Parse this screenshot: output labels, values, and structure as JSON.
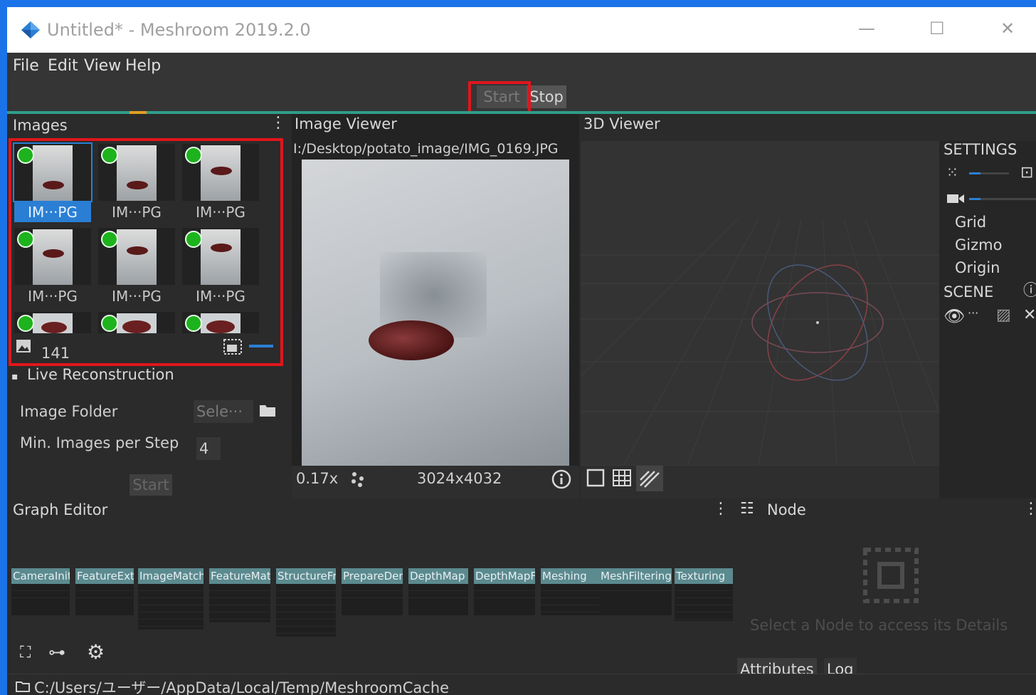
{
  "window": {
    "title": "Untitled* - Meshroom 2019.2.0",
    "minimize": "—",
    "maximize": "☐",
    "close": "✕"
  },
  "menu": [
    "File",
    "Edit",
    "View",
    "Help"
  ],
  "toolbar": {
    "start": "Start",
    "stop": "Stop"
  },
  "images": {
    "title": "Images",
    "thumbnails": [
      "IM···PG",
      "IM···PG",
      "IM···PG",
      "IM···PG",
      "IM···PG",
      "IM···PG"
    ],
    "count": "141"
  },
  "live": {
    "title": "Live Reconstruction",
    "folder_label": "Image Folder",
    "folder_placeholder": "Sele···",
    "min_label": "Min. Images per Step",
    "min_value": "4",
    "start": "Start"
  },
  "image_viewer": {
    "title": "Image Viewer",
    "path": "I:/Desktop/potato_image/IMG_0169.JPG",
    "zoom": "0.17x",
    "resolution": "3024x4032"
  },
  "viewer3d": {
    "title": "3D Viewer",
    "settings": "SETTINGS",
    "grid": "Grid",
    "gizmo": "Gizmo",
    "origin": "Origin",
    "scene": "SCENE"
  },
  "graph": {
    "title": "Graph Editor",
    "nodes": [
      "CameraInit",
      "FeatureExtraction",
      "ImageMatching",
      "FeatureMatching",
      "StructureFromMotion",
      "PrepareDenseScene",
      "DepthMap",
      "DepthMapFilter",
      "Meshing",
      "MeshFiltering",
      "Texturing"
    ]
  },
  "node_panel": {
    "title": "Node",
    "message": "Select a Node to access its Details",
    "tab_attributes": "Attributes",
    "tab_log": "Log"
  },
  "status": {
    "cache_path": "C:/Users/ユーザー/AppData/Local/Temp/MeshroomCache"
  },
  "colors": {
    "accent": "#2a7fd4",
    "highlight": "#e0161c",
    "progress": "#2f9e8a",
    "node_header": "#5b8a8f"
  }
}
